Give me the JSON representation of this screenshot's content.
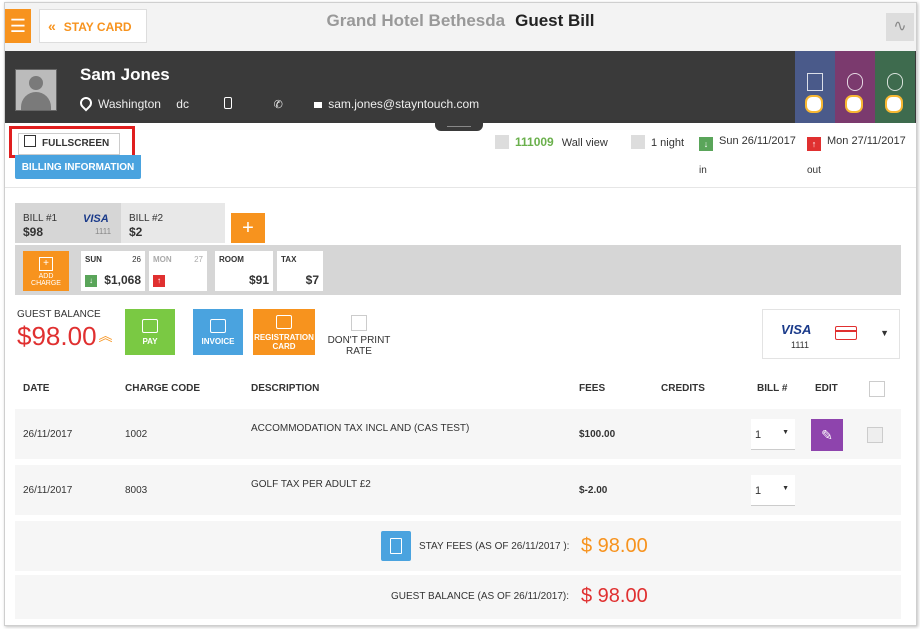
{
  "header": {
    "stay_card_label": "STAY CARD",
    "hotel_name": "Grand Hotel Bethesda",
    "page_title": "Guest Bill"
  },
  "guest": {
    "name": "Sam Jones",
    "city": "Washington",
    "state": "dc",
    "email": "sam.jones@stayntouch.com"
  },
  "controls": {
    "fullscreen_label": "FULLSCREEN",
    "billing_info_label": "BILLING INFORMATION"
  },
  "stay": {
    "room_number": "111009",
    "room_type": "Wall view",
    "nights": "1 night",
    "arrival_date": "Sun 26/11/2017",
    "arrival_label": "in",
    "departure_date": "Mon 27/11/2017",
    "departure_label": "out"
  },
  "bills": [
    {
      "name": "BILL #1",
      "amount": "$98",
      "card_brand": "VISA",
      "card_digits": "1111"
    },
    {
      "name": "BILL #2",
      "amount": "$2"
    }
  ],
  "add_bill_label": "+",
  "charge_strip": {
    "add_charge_label": "ADD CHARGE",
    "days": [
      {
        "day": "SUN",
        "date": "26",
        "amount": "$1,068"
      },
      {
        "day": "MON",
        "date": "27"
      }
    ],
    "room": {
      "label": "ROOM",
      "amount": "$91"
    },
    "tax": {
      "label": "TAX",
      "amount": "$7"
    }
  },
  "balance": {
    "label": "GUEST BALANCE",
    "value": "$98.00"
  },
  "actions": {
    "pay": "PAY",
    "invoice": "INVOICE",
    "registration_card": "REGISTRATION CARD",
    "dont_print_rate": "DON'T PRINT RATE"
  },
  "payment_card": {
    "brand": "VISA",
    "digits": "1111"
  },
  "table": {
    "headers": {
      "date": "DATE",
      "charge_code": "CHARGE CODE",
      "description": "DESCRIPTION",
      "fees": "FEES",
      "credits": "CREDITS",
      "bill_no": "BILL #",
      "edit": "EDIT"
    },
    "rows": [
      {
        "date": "26/11/2017",
        "code": "1002",
        "description": "ACCOMMODATION TAX INCL AND (CAS TEST)",
        "fees": "$100.00",
        "credits": "",
        "bill": "1"
      },
      {
        "date": "26/11/2017",
        "code": "8003",
        "description": "GOLF TAX PER ADULT £2",
        "fees": "$-2.00",
        "credits": "",
        "bill": "1"
      }
    ]
  },
  "summary": {
    "stay_fees_label": "STAY FEES (AS OF 26/11/2017 ):",
    "stay_fees_value": "$ 98.00",
    "guest_balance_label": "GUEST BALANCE (AS OF 26/11/2017):",
    "guest_balance_value": "$ 98.00"
  },
  "colors": {
    "accent_orange": "#f7931e",
    "balance_red": "#e03030",
    "pay_green": "#7ac943",
    "invoice_blue": "#4aa3df",
    "edit_purple": "#8e44ad",
    "room_green": "#6ab04c"
  }
}
